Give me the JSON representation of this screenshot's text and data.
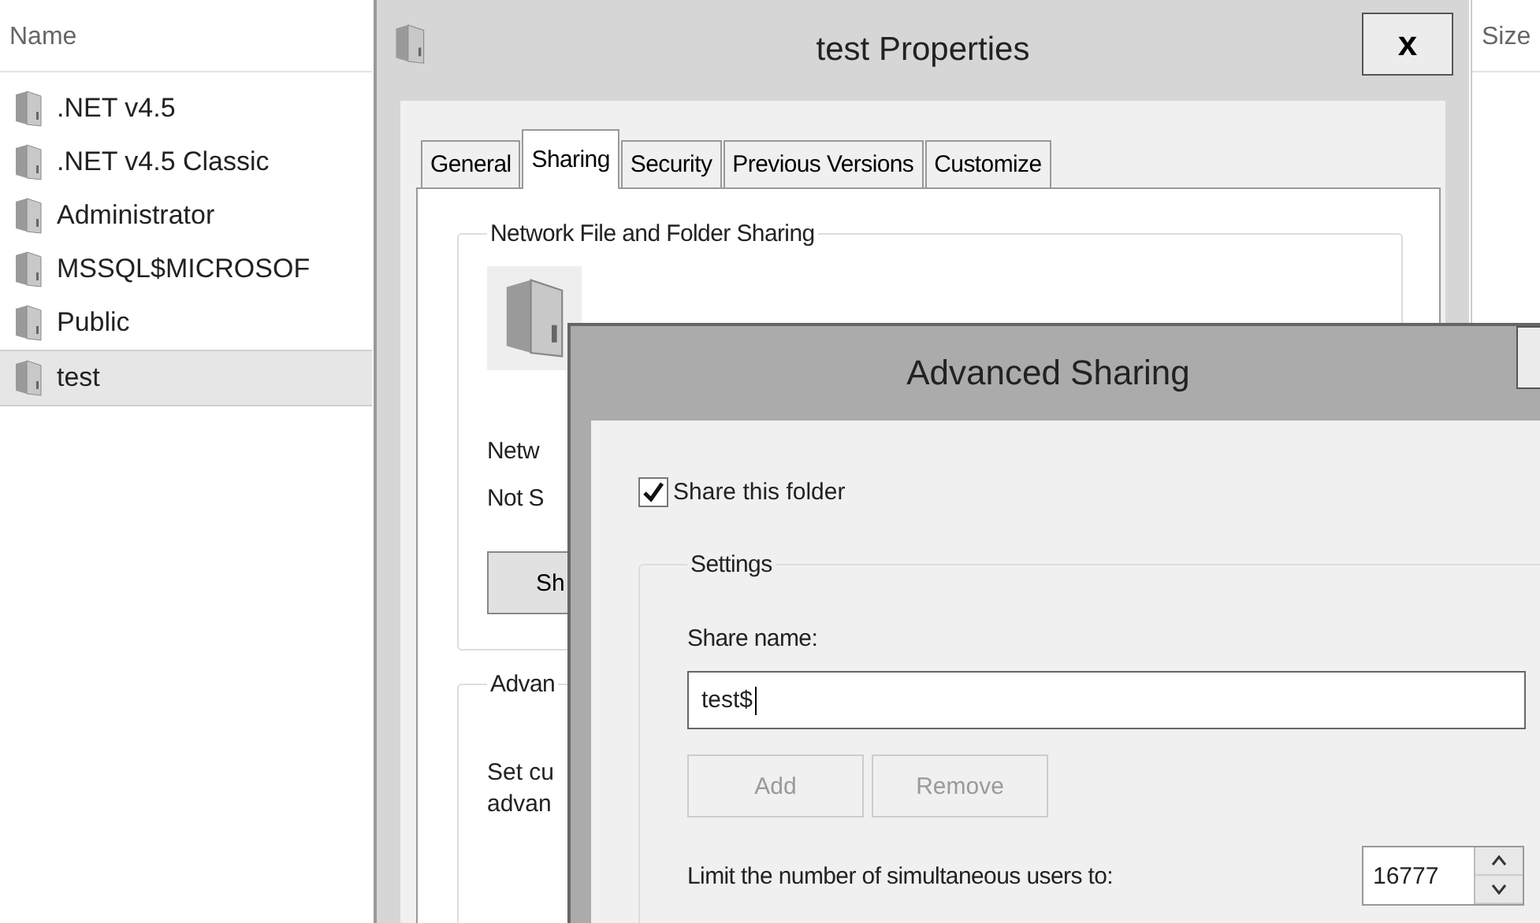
{
  "explorer": {
    "columns": [
      {
        "label": "Name"
      },
      {
        "label": "Size"
      }
    ],
    "items": [
      {
        "name": ".NET v4.5",
        "selected": false
      },
      {
        "name": ".NET v4.5 Classic",
        "selected": false
      },
      {
        "name": "Administrator",
        "selected": false
      },
      {
        "name": "MSSQL$MICROSOF",
        "selected": false
      },
      {
        "name": "Public",
        "selected": false
      },
      {
        "name": "test",
        "selected": true
      }
    ]
  },
  "properties_window": {
    "title": "test Properties",
    "close": "x",
    "tabs": [
      {
        "label": "General",
        "selected": false
      },
      {
        "label": "Sharing",
        "selected": true
      },
      {
        "label": "Security",
        "selected": false
      },
      {
        "label": "Previous Versions",
        "selected": false
      },
      {
        "label": "Customize",
        "selected": false
      }
    ],
    "sharing_group": {
      "title": "Network File and Folder Sharing",
      "status_lines": [
        "Netw",
        "Not S"
      ],
      "button": "Sh"
    },
    "advanced_group": {
      "title": "Advan",
      "description_lines": [
        "Set cu",
        "advan"
      ]
    }
  },
  "advanced_sharing": {
    "title": "Advanced Sharing",
    "share_checkbox": {
      "label": "Share this folder",
      "checked": true
    },
    "settings": {
      "title": "Settings",
      "share_name_label": "Share name:",
      "share_name_value": "test$",
      "buttons": [
        {
          "label": "Add",
          "disabled": true
        },
        {
          "label": "Remove",
          "disabled": true
        }
      ],
      "limit_label": "Limit the number of simultaneous users to:",
      "limit_value": "16777"
    }
  }
}
